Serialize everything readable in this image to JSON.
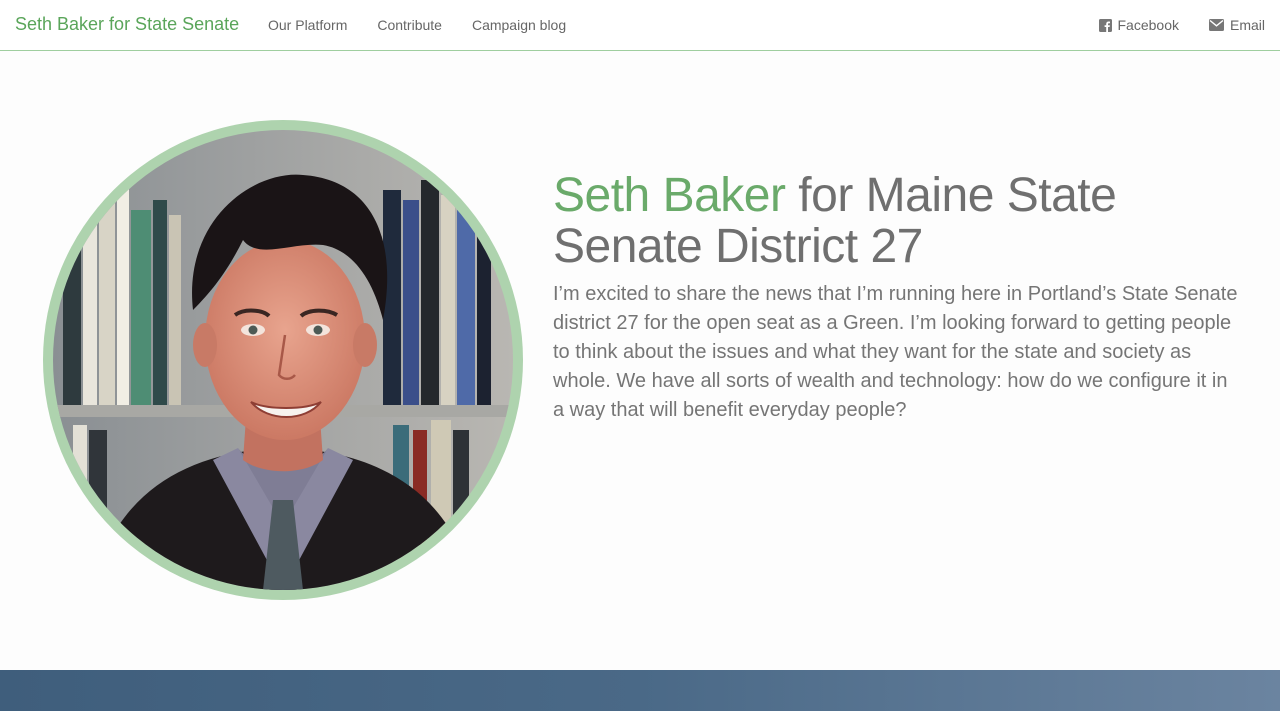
{
  "nav": {
    "brand": "Seth Baker for State Senate",
    "links": [
      {
        "label": "Our Platform"
      },
      {
        "label": "Contribute"
      },
      {
        "label": "Campaign blog"
      }
    ],
    "social": [
      {
        "label": "Facebook",
        "icon": "facebook-icon"
      },
      {
        "label": "Email",
        "icon": "envelope-icon"
      }
    ]
  },
  "hero": {
    "headline_name": "Seth Baker",
    "headline_rest": " for Maine State Senate District 27",
    "intro": "I’m excited to share the news that I’m running here in Portland’s State Senate district 27 for the open seat as a Green. I’m looking forward to getting people to think about the issues and what they want for the state and society as whole. We have all sorts of wealth and technology: how do we configure it in a way that will benefit everyday people?"
  },
  "colors": {
    "brand_green": "#5aa55a",
    "portrait_ring": "#aed3ae",
    "footer_band": "#4a6987"
  }
}
